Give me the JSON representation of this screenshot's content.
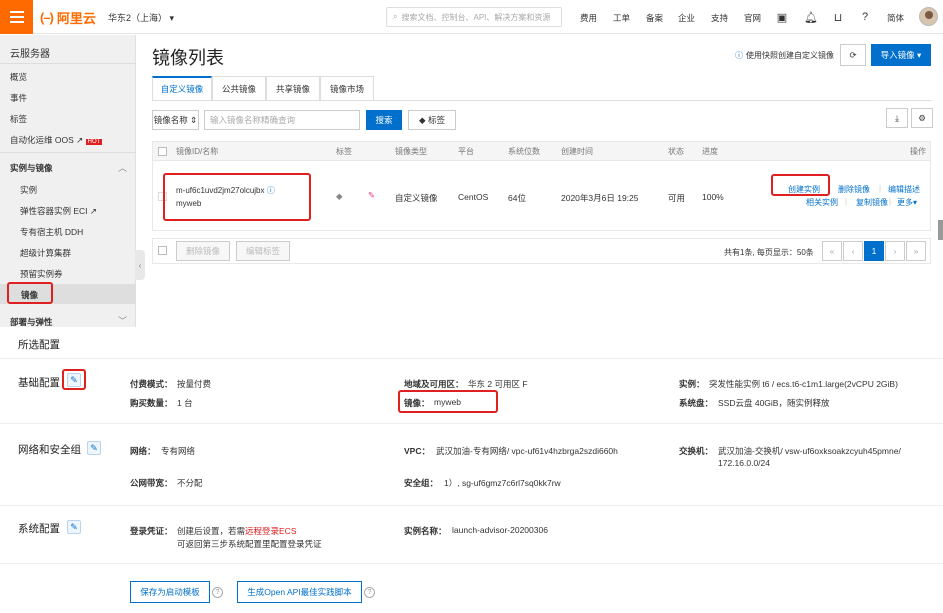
{
  "topbar": {
    "logo_mark": "(–)",
    "logo_text": "阿里云",
    "region": "华东2（上海）",
    "search_placeholder": "搜索文档、控制台、API、解决方案和资源",
    "nav": [
      "费用",
      "工单",
      "备案",
      "企业",
      "支持",
      "官网"
    ],
    "lang": "简体"
  },
  "sidebar": {
    "title": "云服务器",
    "items": [
      "概览",
      "事件",
      "标签",
      "自动化运维 OOS"
    ],
    "hot_badge": "HOT",
    "section1": "实例与镜像",
    "section1_items": [
      "实例",
      "弹性容器实例 ECI",
      "专有宿主机 DDH",
      "超级计算集群",
      "预留实例券",
      "镜像"
    ],
    "section2": "部署与弹性"
  },
  "main": {
    "title": "镜像列表",
    "quick_help": "使用快照创建自定义镜像",
    "import_button": "导入镜像",
    "tabs": [
      "自定义镜像",
      "公共镜像",
      "共享镜像",
      "镜像市场"
    ],
    "filter_select": "镜像名称",
    "filter_placeholder": "输入镜像名称精确查询",
    "search_button": "搜索",
    "tag_button": "标签",
    "columns": [
      "镜像ID/名称",
      "标签",
      "镜像类型",
      "平台",
      "系统位数",
      "创建时间",
      "状态",
      "进度",
      "操作"
    ],
    "row": {
      "id": "m-uf6c1uvd2jm27olcujbx",
      "name": "myweb",
      "type": "自定义镜像",
      "platform": "CentOS",
      "bits": "64位",
      "created": "2020年3月6日 19:25",
      "status": "可用",
      "progress": "100%",
      "actions": [
        "创建实例",
        "删除镜像",
        "编辑描述",
        "相关实例",
        "复制镜像",
        "更多"
      ]
    },
    "bulk_delete": "删除镜像",
    "bulk_edit_tag": "编辑标签",
    "pagination_info": "共有1条, 每页显示：50条",
    "page": "1"
  },
  "config": {
    "header": "所选配置",
    "basic": {
      "title": "基础配置",
      "pay_label": "付费模式：",
      "pay_value": "按量付费",
      "qty_label": "购买数量：",
      "qty_value": "1 台",
      "zone_label": "地域及可用区：",
      "zone_value": "华东 2 可用区 F",
      "image_label": "镜像：",
      "image_value": "myweb",
      "inst_label": "实例：",
      "inst_value": "突发性能实例 t6 / ecs.t6-c1m1.large(2vCPU 2GiB)",
      "disk_label": "系统盘：",
      "disk_value": "SSD云盘 40GiB，随实例释放"
    },
    "network": {
      "title": "网络和安全组",
      "net_label": "网络：",
      "net_value": "专有网络",
      "vpc_label": "VPC：",
      "vpc_value": "武汉加油-专有网络/ vpc-uf61v4hzbrga2szdi660h",
      "sw_label": "交换机：",
      "sw_value1": "武汉加油-交换机/ vsw-uf6oxksoakzcyuh45pmne/",
      "sw_value2": "172.16.0.0/24",
      "bw_label": "公网带宽：",
      "bw_value": "不分配",
      "sg_label": "安全组：",
      "sg_value": "1）, sg-uf6gmz7c6rl7sq0kk7rw"
    },
    "system": {
      "title": "系统配置",
      "login_label": "登录凭证：",
      "login_value_pre": "创建后设置，若需",
      "login_link": "远程登录ECS",
      "login_value2": "可返回第三步系统配置里配置登录凭证",
      "name_label": "实例名称：",
      "name_value": "launch-advisor-20200306"
    },
    "save_template": "保存为启动模板",
    "gen_api": "生成Open API最佳实践脚本"
  }
}
